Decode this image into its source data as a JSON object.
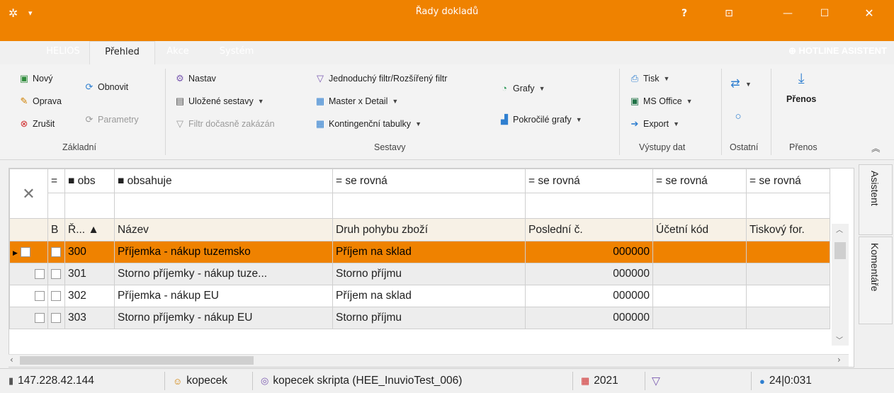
{
  "window": {
    "title": "Řady dokladů",
    "help": "?",
    "pin_glyph": "⊡",
    "min_glyph": "—",
    "max_glyph": "☐",
    "close_glyph": "✕",
    "logo_glyph": "✲",
    "menu_dd": "▾"
  },
  "menu": {
    "tabs": [
      "HELIOS",
      "Přehled",
      "Akce",
      "Systém"
    ],
    "hotline": "⊕ HOTLINE ASISTENT"
  },
  "ribbon": {
    "zakladni": {
      "novy": "Nový",
      "oprava": "Oprava",
      "zrusit": "Zrušit",
      "obnovit": "Obnovit",
      "parametry": "Parametry",
      "label": "Základní"
    },
    "sestavy": {
      "nastav": "Nastav",
      "ulozene": "Uložené sestavy",
      "filtr_dis": "Filtr dočasně zakázán",
      "jednoduchy": "Jednoduchý filtr/Rozšířený filtr",
      "master": "Master x Detail",
      "kontingencni": "Kontingenční tabulky",
      "grafy": "Grafy",
      "pokrocile": "Pokročilé grafy",
      "label": "Sestavy"
    },
    "vystupy": {
      "tisk": "Tisk",
      "office": "MS Office",
      "export": "Export",
      "label": "Výstupy dat"
    },
    "ostatni": {
      "label": "Ostatní"
    },
    "prenos": {
      "button": "Přenos",
      "label": "Přenos"
    },
    "collapse": "︽"
  },
  "grid": {
    "clear_filter": "✕",
    "filter_ops": [
      "=",
      "■ obs",
      "■ obsahuje",
      "= se rovná",
      "= se rovná",
      "= se rovná",
      "= se rovná"
    ],
    "columns": [
      "B",
      "Ř...  ▲",
      "Název",
      "Druh pohybu zboží",
      "Poslední č.",
      "Účetní kód",
      "Tiskový for."
    ],
    "rows": [
      {
        "rada": "300",
        "nazev": "Příjemka - nákup tuzemsko",
        "druh": "Příjem na sklad",
        "posledni": "000000",
        "ucetni": "",
        "tisk": ""
      },
      {
        "rada": "301",
        "nazev": "Storno příjemky - nákup tuze...",
        "druh": "Storno příjmu",
        "posledni": "000000",
        "ucetni": "",
        "tisk": ""
      },
      {
        "rada": "302",
        "nazev": "Příjemka - nákup EU",
        "druh": "Příjem na sklad",
        "posledni": "000000",
        "ucetni": "",
        "tisk": ""
      },
      {
        "rada": "303",
        "nazev": "Storno příjemky - nákup EU",
        "druh": "Storno příjmu",
        "posledni": "000000",
        "ucetni": "",
        "tisk": ""
      }
    ]
  },
  "side_tabs": [
    "Asistent",
    "Komentáře"
  ],
  "status": {
    "ip": "147.228.42.144",
    "user": "kopecek",
    "db": "kopecek skripta (HEE_InuvioTest_006)",
    "year": "2021",
    "info": "24|0:031"
  }
}
